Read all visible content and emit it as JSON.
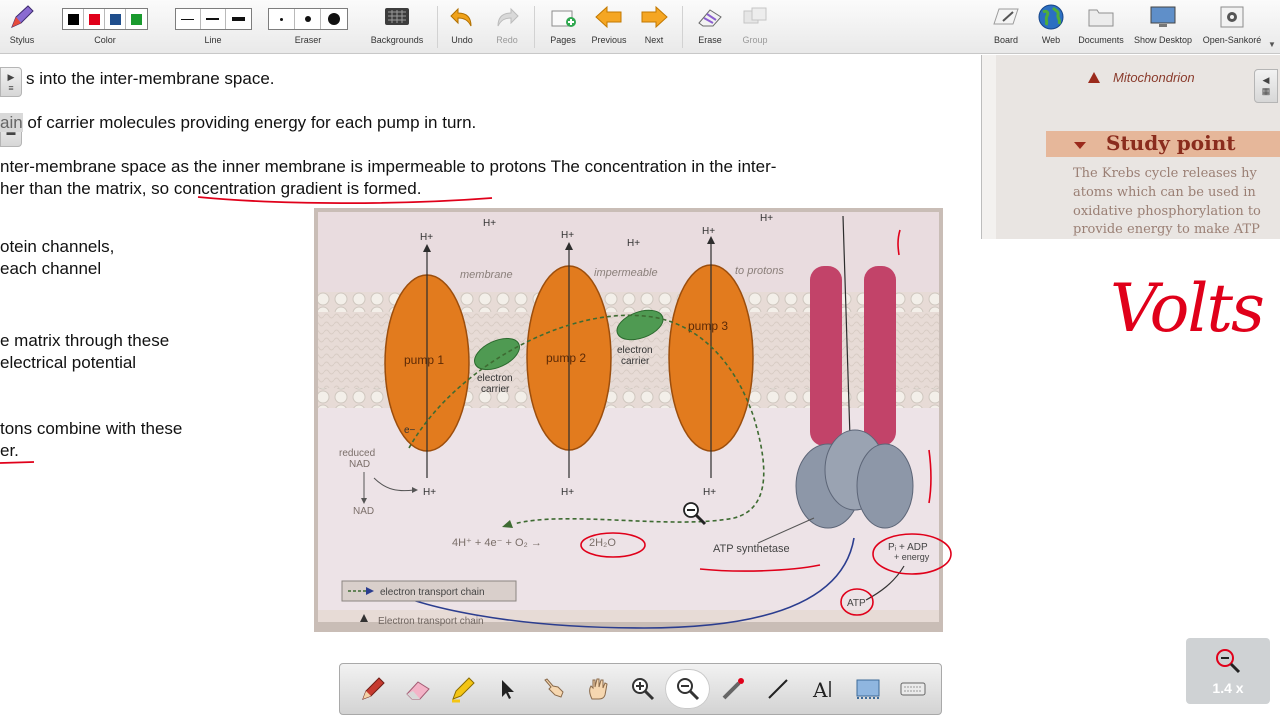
{
  "toolbar": {
    "stylus": "Stylus",
    "color": "Color",
    "line": "Line",
    "eraser": "Eraser",
    "backgrounds": "Backgrounds",
    "undo": "Undo",
    "redo": "Redo",
    "pages": "Pages",
    "previous": "Previous",
    "next": "Next",
    "erase": "Erase",
    "group": "Group",
    "board": "Board",
    "web": "Web",
    "documents": "Documents",
    "show_desktop": "Show Desktop",
    "open_sankore": "Open-Sankoré",
    "colors": [
      "#000000",
      "#e0001a",
      "#1f4e8c",
      "#1a9a2e"
    ]
  },
  "doc": {
    "line1": "s into the inter-membrane space.",
    "line2_prefix": "ain",
    "line2": " of carrier molecules providing energy for each pump in turn.",
    "line3": "nter-membrane space as the inner membrane is impermeable to protons The concentration in the inter-",
    "line4": "her than the matrix, so concentration gradient is formed.",
    "line5": "otein channels,",
    "line6": "each channel",
    "line7": "e matrix through these",
    "line8": " electrical potential",
    "line9": "tons combine with these",
    "line10": "er."
  },
  "figure": {
    "membrane_label_1": "membrane",
    "membrane_label_2": "impermeable",
    "membrane_label_3": "to protons",
    "pump1": "pump 1",
    "pump2": "pump 2",
    "pump3": "pump 3",
    "electron_carrier_1a": "electron",
    "electron_carrier_1b": "carrier",
    "electron_carrier_2a": "electron",
    "electron_carrier_2b": "carrier",
    "h_plus": "H+",
    "electron": "e−",
    "reduced_nad_1": "reduced",
    "reduced_nad_2": "NAD",
    "nad": "NAD",
    "equation": "4H⁺ + 4e⁻ + O₂ →",
    "water": "2H₂O",
    "atp_synthetase": "ATP synthetase",
    "pi_adp": "Pᵢ + ADP",
    "energy": "+ energy",
    "atp": "ATP",
    "legend": "electron transport chain",
    "caption": "Electron transport chain"
  },
  "study": {
    "mito": "Mitochondrion",
    "title": "Study point",
    "text1": "The Krebs cycle releases hy",
    "text2": "atoms which can be used in",
    "text3": "oxidative phosphorylation to",
    "text4": "provide energy to make ATP"
  },
  "annotation": {
    "handwriting": "Volts"
  },
  "zoom": {
    "level": "1.4 x"
  }
}
